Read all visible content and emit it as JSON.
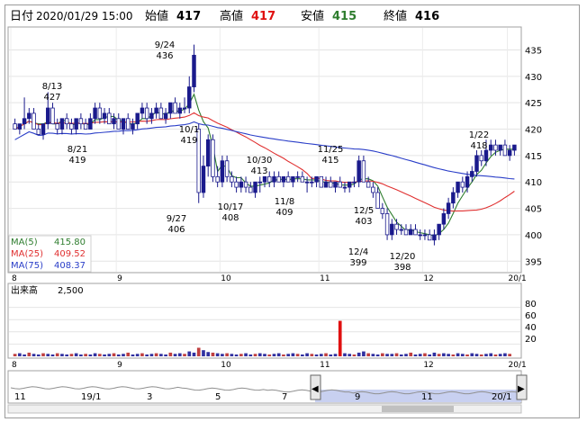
{
  "header": {
    "date_label": "日付",
    "date_value": "2020/01/29 15:00",
    "open_label": "始値",
    "open_value": "417",
    "high_label": "高値",
    "high_value": "417",
    "low_label": "安値",
    "low_value": "415",
    "close_label": "終値",
    "close_value": "416"
  },
  "colors": {
    "candle_up": "#1a1a8c",
    "candle_down": "#ffffff",
    "ma5": "#2e7d2e",
    "ma25": "#e03030",
    "ma75": "#2a3ec8",
    "volume": "#3030a0",
    "volume_spike": "#e01010",
    "high_text": "#e01010",
    "low_text": "#2e7d2e"
  },
  "legend": [
    {
      "name": "MA(5)",
      "value": "415.80",
      "color": "#2e7d2e"
    },
    {
      "name": "MA(25)",
      "value": "409.52",
      "color": "#e03030"
    },
    {
      "name": "MA(75)",
      "value": "408.37",
      "color": "#2a3ec8"
    }
  ],
  "volume_panel": {
    "title": "出来高",
    "unit": "2,500",
    "ticks": [
      "80",
      "60",
      "40",
      "20"
    ]
  },
  "navigator": {
    "labels": [
      "11",
      "19/1",
      "3",
      "5",
      "7",
      "9",
      "11",
      "20/1"
    ],
    "left_arrow_icon": "◀",
    "right_arrow_icon": "▶"
  },
  "chart_data": {
    "type": "candlestick",
    "x_month_labels": [
      "8",
      "9",
      "10",
      "11",
      "12",
      "20/1"
    ],
    "y_ticks": [
      435,
      430,
      425,
      420,
      415,
      410,
      405,
      400,
      395
    ],
    "ylim": [
      393,
      439
    ],
    "volume_ylim": [
      0,
      100
    ],
    "candles": [
      [
        421,
        422,
        420,
        420
      ],
      [
        420,
        421,
        419,
        421
      ],
      [
        421,
        426,
        420,
        422
      ],
      [
        422,
        424,
        421,
        423
      ],
      [
        423,
        424,
        420,
        420
      ],
      [
        420,
        421,
        419,
        419
      ],
      [
        419,
        421,
        418,
        421
      ],
      [
        421,
        427,
        420,
        424
      ],
      [
        424,
        425,
        421,
        421
      ],
      [
        421,
        422,
        419,
        420
      ],
      [
        420,
        422,
        419,
        422
      ],
      [
        422,
        423,
        420,
        421
      ],
      [
        421,
        422,
        419,
        420
      ],
      [
        420,
        422,
        419,
        422
      ],
      [
        422,
        423,
        420,
        421
      ],
      [
        421,
        422,
        420,
        420
      ],
      [
        420,
        423,
        420,
        422
      ],
      [
        422,
        425,
        421,
        424
      ],
      [
        424,
        425,
        421,
        422
      ],
      [
        422,
        424,
        421,
        423
      ],
      [
        423,
        424,
        421,
        421
      ],
      [
        421,
        423,
        420,
        422
      ],
      [
        422,
        423,
        420,
        420
      ],
      [
        420,
        422,
        419,
        422
      ],
      [
        422,
        423,
        420,
        420
      ],
      [
        420,
        422,
        419,
        421
      ],
      [
        421,
        423,
        420,
        423
      ],
      [
        423,
        425,
        422,
        424
      ],
      [
        424,
        425,
        421,
        422
      ],
      [
        422,
        424,
        421,
        423
      ],
      [
        423,
        425,
        422,
        424
      ],
      [
        424,
        425,
        422,
        422
      ],
      [
        422,
        424,
        421,
        423
      ],
      [
        423,
        425,
        422,
        425
      ],
      [
        425,
        426,
        423,
        423
      ],
      [
        423,
        425,
        422,
        424
      ],
      [
        424,
        426,
        423,
        424
      ],
      [
        424,
        430,
        423,
        428
      ],
      [
        428,
        436,
        427,
        434
      ],
      [
        420,
        421,
        406,
        408
      ],
      [
        408,
        415,
        407,
        413
      ],
      [
        413,
        419,
        411,
        418
      ],
      [
        418,
        419,
        410,
        411
      ],
      [
        411,
        413,
        409,
        410
      ],
      [
        410,
        415,
        409,
        414
      ],
      [
        414,
        415,
        410,
        411
      ],
      [
        411,
        412,
        409,
        410
      ],
      [
        410,
        411,
        408,
        409
      ],
      [
        409,
        411,
        408,
        410
      ],
      [
        410,
        411,
        408,
        409
      ],
      [
        409,
        410,
        408,
        408
      ],
      [
        408,
        410,
        407,
        410
      ],
      [
        410,
        411,
        408,
        410
      ],
      [
        410,
        411,
        409,
        411
      ],
      [
        411,
        412,
        409,
        410
      ],
      [
        410,
        412,
        409,
        411
      ],
      [
        411,
        412,
        410,
        410
      ],
      [
        410,
        411,
        409,
        411
      ],
      [
        411,
        412,
        410,
        410
      ],
      [
        410,
        411,
        409,
        411
      ],
      [
        411,
        412,
        410,
        411
      ],
      [
        411,
        412,
        410,
        410
      ],
      [
        410,
        411,
        408,
        410
      ],
      [
        410,
        411,
        409,
        410
      ],
      [
        410,
        411,
        409,
        411
      ],
      [
        411,
        411,
        409,
        409
      ],
      [
        409,
        411,
        409,
        410
      ],
      [
        410,
        411,
        409,
        409
      ],
      [
        409,
        410,
        408,
        410
      ],
      [
        410,
        411,
        409,
        409
      ],
      [
        409,
        410,
        408,
        409
      ],
      [
        409,
        410,
        408,
        410
      ],
      [
        410,
        411,
        409,
        410
      ],
      [
        410,
        415,
        409,
        414
      ],
      [
        414,
        415,
        410,
        410
      ],
      [
        410,
        411,
        409,
        409
      ],
      [
        409,
        410,
        407,
        408
      ],
      [
        408,
        409,
        405,
        405
      ],
      [
        405,
        406,
        403,
        404
      ],
      [
        404,
        405,
        399,
        400
      ],
      [
        400,
        403,
        399,
        402
      ],
      [
        402,
        403,
        400,
        401
      ],
      [
        401,
        402,
        400,
        401
      ],
      [
        401,
        402,
        400,
        400
      ],
      [
        400,
        402,
        400,
        401
      ],
      [
        401,
        402,
        400,
        400
      ],
      [
        400,
        401,
        399,
        400
      ],
      [
        400,
        401,
        399,
        400
      ],
      [
        400,
        401,
        399,
        399
      ],
      [
        399,
        401,
        398,
        400
      ],
      [
        400,
        402,
        399,
        402
      ],
      [
        402,
        405,
        401,
        404
      ],
      [
        404,
        407,
        403,
        406
      ],
      [
        406,
        409,
        405,
        408
      ],
      [
        408,
        410,
        407,
        410
      ],
      [
        410,
        411,
        408,
        409
      ],
      [
        409,
        412,
        408,
        411
      ],
      [
        411,
        413,
        410,
        412
      ],
      [
        412,
        416,
        411,
        415
      ],
      [
        415,
        416,
        413,
        414
      ],
      [
        414,
        418,
        413,
        416
      ],
      [
        416,
        418,
        415,
        417
      ],
      [
        417,
        418,
        415,
        416
      ],
      [
        416,
        417,
        415,
        417
      ],
      [
        417,
        418,
        415,
        415
      ],
      [
        415,
        417,
        414,
        416
      ],
      [
        416,
        417,
        415,
        417
      ]
    ],
    "volume": [
      4,
      5,
      3,
      6,
      4,
      3,
      5,
      4,
      3,
      5,
      4,
      3,
      4,
      5,
      3,
      4,
      3,
      5,
      4,
      3,
      4,
      5,
      3,
      4,
      6,
      3,
      4,
      5,
      3,
      4,
      5,
      4,
      3,
      6,
      4,
      5,
      4,
      8,
      6,
      14,
      10,
      7,
      6,
      5,
      4,
      5,
      4,
      3,
      4,
      5,
      3,
      4,
      5,
      4,
      3,
      4,
      5,
      3,
      4,
      5,
      4,
      3,
      5,
      4,
      3,
      4,
      5,
      3,
      4,
      58,
      5,
      4,
      3,
      6,
      8,
      5,
      4,
      3,
      5,
      4,
      4,
      5,
      3,
      4,
      6,
      3,
      4,
      5,
      3,
      6,
      4,
      5,
      4,
      3,
      5,
      4,
      3,
      5,
      4,
      3,
      4,
      5,
      3,
      4,
      5,
      4
    ],
    "peak_labels": [
      {
        "date": "8/13",
        "value": "427"
      },
      {
        "date": "8/21",
        "value": "419"
      },
      {
        "date": "9/24",
        "value": "436"
      },
      {
        "date": "9/27",
        "value": "406"
      },
      {
        "date": "10/1",
        "value": "419"
      },
      {
        "date": "10/17",
        "value": "408"
      },
      {
        "date": "10/30",
        "value": "413"
      },
      {
        "date": "11/8",
        "value": "409"
      },
      {
        "date": "11/25",
        "value": "415"
      },
      {
        "date": "12/5",
        "value": "403"
      },
      {
        "date": "12/4",
        "value": "399"
      },
      {
        "date": "12/20",
        "value": "398"
      },
      {
        "date": "1/22",
        "value": "418"
      }
    ]
  }
}
